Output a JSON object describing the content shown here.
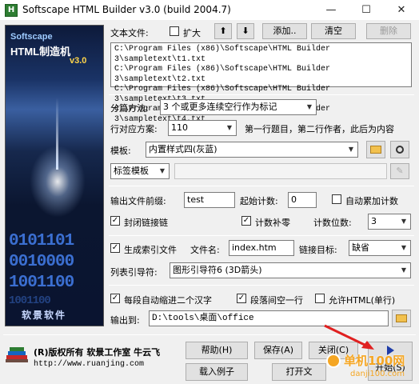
{
  "titlebar": {
    "title": "Softscape HTML Builder v3.0 (build 2004.7)",
    "minimize": "—",
    "maximize": "☐",
    "close": "✕"
  },
  "banner": {
    "brand": "Softscape",
    "title": "HTML制造机",
    "version": "v3.0",
    "binary": [
      "0101101",
      "0010000",
      "1001100",
      "1001100"
    ],
    "cn": "软景软件"
  },
  "files": {
    "label": "文本文件:",
    "expand_label": "扩大",
    "up_glyph": "⬆",
    "down_glyph": "⬇",
    "add_label": "添加..",
    "clear_label": "清空",
    "delete_label": "删除",
    "items": [
      "C:\\Program Files (x86)\\Softscape\\HTML Builder 3\\sampletext\\t1.txt",
      "C:\\Program Files (x86)\\Softscape\\HTML Builder 3\\sampletext\\t2.txt",
      "C:\\Program Files (x86)\\Softscape\\HTML Builder 3\\sampletext\\t3.txt",
      "C:\\Program Files (x86)\\Softscape\\HTML Builder 3\\sampletext\\t4.txt"
    ]
  },
  "split": {
    "label": "分篇方法:",
    "value": "3 个或更多连续空行作为标记"
  },
  "lines": {
    "label": "行对应方案:",
    "value": "110",
    "hint": "第一行题目，第二行作者，此后为内容"
  },
  "template": {
    "label": "模板:",
    "value": "内置样式四(灰蓝)"
  },
  "tag_template": {
    "label": "标签模板"
  },
  "output": {
    "prefix_label": "输出文件前缀:",
    "prefix_value": "test",
    "start_label": "起始计数:",
    "start_value": "0",
    "auto_label": "自动累加计数",
    "seal_label": "封闭链接链",
    "zero_label": "计数补零",
    "digits_label": "计数位数:",
    "digits_value": "3"
  },
  "index": {
    "gen_label": "生成索引文件",
    "filename_label": "文件名:",
    "filename_value": "index.htm",
    "target_label": "链接目标:",
    "target_value": "缺省",
    "guide_label": "列表引导符:",
    "guide_value": "图形引导符6 (3D箭头)"
  },
  "options": {
    "indent_label": "每段自动缩进二个汉字",
    "blank_label": "段落间空一行",
    "html_label": "允许HTML(单行)"
  },
  "outdir": {
    "label": "输出到:",
    "value": "D:\\tools\\桌面\\office"
  },
  "footer": {
    "copyright": "(R)版权所有 软景工作室 牛云飞",
    "url": "http://www.ruanjing.com"
  },
  "buttons": {
    "help": "帮助(H)",
    "save": "保存(A)",
    "close": "关闭(C)",
    "load": "载入例子",
    "open": "打开文",
    "start": "开始(S)"
  },
  "watermark": {
    "text": "单机100网",
    "url": "danji100.com"
  },
  "colors": {
    "arrow": "#e02020",
    "banner_bin": "#3b6fd1"
  }
}
